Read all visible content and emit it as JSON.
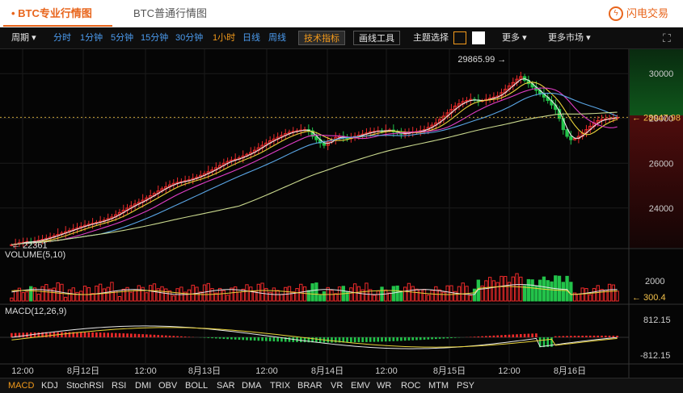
{
  "tabs": {
    "active": "BTC专业行情图",
    "second": "BTC普通行情图"
  },
  "brand": {
    "label": "闪电交易"
  },
  "toolbar": {
    "period_label": "周期",
    "periods": [
      "分时",
      "1分钟",
      "5分钟",
      "15分钟",
      "30分钟",
      "1小时",
      "日线",
      "周线"
    ],
    "active_period": "1小时",
    "tech_indicator": "技术指标",
    "draw_tools": "画线工具",
    "theme_label": "主题选择",
    "more": "更多",
    "more_markets": "更多市场"
  },
  "colors": {
    "up": "#ee2a2a",
    "down": "#23c34a",
    "background": "#050505",
    "accent": "#e8651c"
  },
  "indicators": [
    "MACD",
    "KDJ",
    "StochRSI",
    "RSI",
    "DMI",
    "OBV",
    "BOLL",
    "SAR",
    "DMA",
    "TRIX",
    "BRAR",
    "VR",
    "EMV",
    "WR",
    "ROC",
    "MTM",
    "PSY"
  ],
  "active_indicator": "MACD",
  "chart_data": {
    "type": "candlestick",
    "price_axis": {
      "ticks": [
        24000,
        26000,
        28000,
        30000
      ],
      "range": [
        22300,
        30800
      ]
    },
    "time_ticks": [
      "12:00",
      "8月12日",
      "12:00",
      "8月13日",
      "12:00",
      "8月14日",
      "12:00",
      "8月15日",
      "12:00",
      "8月16日"
    ],
    "annotations": {
      "high": "29865.99",
      "low": "22361",
      "last": "28047.98"
    },
    "closes": [
      22361,
      22400,
      22450,
      22470,
      22500,
      22480,
      22520,
      22560,
      22600,
      22650,
      22700,
      22760,
      22820,
      22880,
      22940,
      23000,
      23060,
      23120,
      23180,
      23230,
      23280,
      23320,
      23360,
      23410,
      23460,
      23530,
      23600,
      23700,
      23800,
      23900,
      24000,
      24100,
      24180,
      24260,
      24350,
      24450,
      24550,
      24650,
      24760,
      24860,
      24950,
      25030,
      25100,
      25150,
      25180,
      25220,
      25260,
      25320,
      25380,
      25460,
      25540,
      25620,
      25700,
      25800,
      25900,
      26000,
      26080,
      26140,
      26180,
      26240,
      26320,
      26400,
      26480,
      26580,
      26690,
      26800,
      26900,
      27000,
      27080,
      27160,
      27240,
      27320,
      27380,
      27420,
      27450,
      27480,
      27500,
      27450,
      27200,
      27050,
      26900,
      26800,
      26950,
      27050,
      27150,
      27200,
      27150,
      27100,
      27150,
      27200,
      27250,
      27300,
      27350,
      27400,
      27420,
      27450,
      27430,
      27460,
      27480,
      27400,
      27350,
      27300,
      27330,
      27380,
      27400,
      27420,
      27450,
      27500,
      27600,
      27700,
      27800,
      27950,
      28100,
      28250,
      28400,
      28550,
      28650,
      28750,
      28800,
      28850,
      28820,
      28780,
      28800,
      28850,
      28900,
      28950,
      29000,
      29150,
      29300,
      29450,
      29600,
      29750,
      29865,
      29700,
      29550,
      29400,
      29250,
      29100,
      28950,
      28800,
      28600,
      28400,
      28000,
      27500,
      27200,
      27050,
      27100,
      27200,
      27350,
      27500,
      27650,
      27800,
      27900,
      27950,
      27980,
      28000,
      28020,
      28047
    ],
    "volume": {
      "label": "VOLUME(5,10)",
      "ticks": [
        2000
      ],
      "last": "300.4"
    },
    "macd": {
      "label": "MACD(12,26,9)",
      "ticks": [
        812.15,
        -812.15
      ]
    }
  }
}
